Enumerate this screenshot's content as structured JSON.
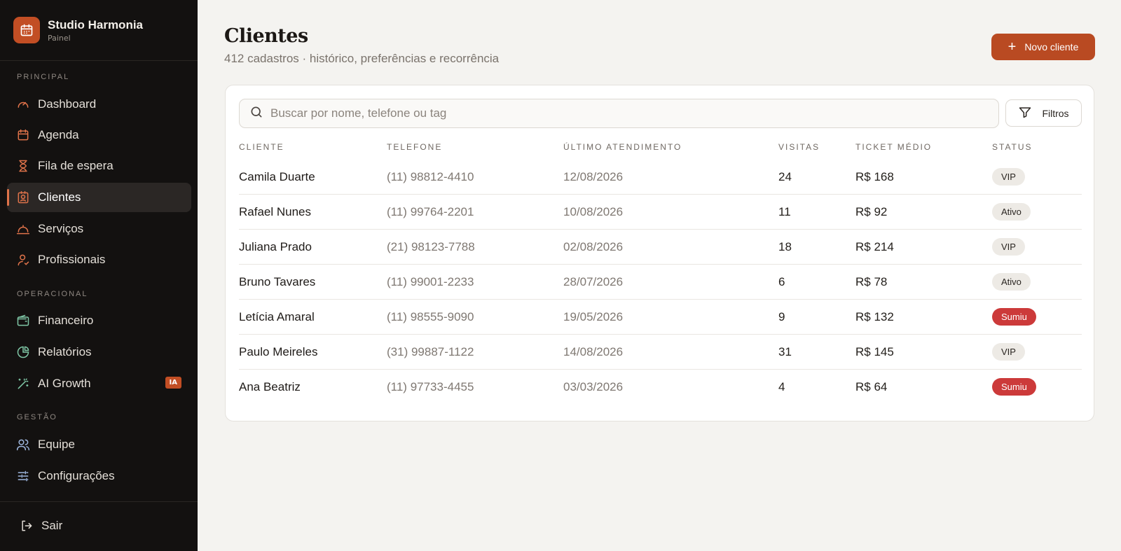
{
  "brand": {
    "name": "Studio Harmonia",
    "subtitle": "Painel",
    "icon": "calendar-icon"
  },
  "sidebar": {
    "sections": [
      {
        "label": "PRINCIPAL"
      },
      {
        "label": "OPERACIONAL"
      },
      {
        "label": "GESTÃO"
      }
    ],
    "items": [
      {
        "label": "Dashboard",
        "icon": "gauge-icon"
      },
      {
        "label": "Agenda",
        "icon": "calendar-icon"
      },
      {
        "label": "Fila de espera",
        "icon": "hourglass-icon"
      },
      {
        "label": "Clientes",
        "icon": "contact-card-icon",
        "active": true
      },
      {
        "label": "Serviços",
        "icon": "service-bell-icon"
      },
      {
        "label": "Profissionais",
        "icon": "user-icon"
      },
      {
        "label": "Financeiro",
        "icon": "wallet-icon"
      },
      {
        "label": "Relatórios",
        "icon": "pie-chart-icon"
      },
      {
        "label": "AI Growth",
        "icon": "magic-wand-icon",
        "badge": "IA"
      },
      {
        "label": "Equipe",
        "icon": "users-icon"
      },
      {
        "label": "Configurações",
        "icon": "sliders-icon"
      }
    ],
    "logout": {
      "label": "Sair",
      "icon": "logout-icon"
    }
  },
  "header": {
    "title": "Clientes",
    "subtitle": "412 cadastros · histórico, preferências e recorrência",
    "new_button": "Novo cliente"
  },
  "search": {
    "placeholder": "Buscar por nome, telefone ou tag"
  },
  "filters": {
    "label": "Filtros"
  },
  "table": {
    "columns": [
      "CLIENTE",
      "TELEFONE",
      "ÚLTIMO ATENDIMENTO",
      "VISITAS",
      "TICKET MÉDIO",
      "STATUS"
    ],
    "rows": [
      {
        "cliente": "Camila Duarte",
        "telefone": "(11) 98812-4410",
        "ultimo": "12/08/2026",
        "visitas": "24",
        "ticket": "R$ 168",
        "status": "VIP"
      },
      {
        "cliente": "Rafael Nunes",
        "telefone": "(11) 99764-2201",
        "ultimo": "10/08/2026",
        "visitas": "11",
        "ticket": "R$ 92",
        "status": "Ativo"
      },
      {
        "cliente": "Juliana Prado",
        "telefone": "(21) 98123-7788",
        "ultimo": "02/08/2026",
        "visitas": "18",
        "ticket": "R$ 214",
        "status": "VIP"
      },
      {
        "cliente": "Bruno Tavares",
        "telefone": "(11) 99001-2233",
        "ultimo": "28/07/2026",
        "visitas": "6",
        "ticket": "R$ 78",
        "status": "Ativo"
      },
      {
        "cliente": "Letícia Amaral",
        "telefone": "(11) 98555-9090",
        "ultimo": "19/05/2026",
        "visitas": "9",
        "ticket": "R$ 132",
        "status": "Sumiu"
      },
      {
        "cliente": "Paulo Meireles",
        "telefone": "(31) 99887-1122",
        "ultimo": "14/08/2026",
        "visitas": "31",
        "ticket": "R$ 145",
        "status": "VIP"
      },
      {
        "cliente": "Ana Beatriz",
        "telefone": "(11) 97733-4455",
        "ultimo": "03/03/2026",
        "visitas": "4",
        "ticket": "R$ 64",
        "status": "Sumiu"
      }
    ]
  },
  "colors": {
    "accent": "#c24e24",
    "sidebar_bg": "#131110",
    "page_bg": "#f4f3f0",
    "status_sumiu": "#cc3a3a",
    "status_neutral": "#edeae5"
  }
}
